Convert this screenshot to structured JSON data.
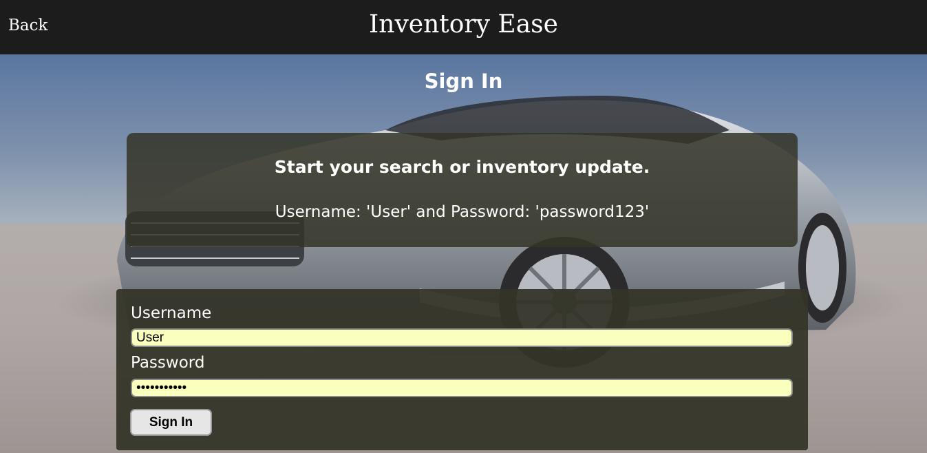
{
  "header": {
    "back_label": "Back",
    "app_title": "Inventory Ease"
  },
  "page": {
    "heading": "Sign In"
  },
  "info_panel": {
    "headline": "Start your search or inventory update.",
    "credentials_hint": "Username: 'User' and Password: 'password123'"
  },
  "form": {
    "username_label": "Username",
    "username_value": "User",
    "password_label": "Password",
    "password_value": "password123",
    "submit_label": "Sign In"
  },
  "colors": {
    "header_bg": "#1c1c1c",
    "panel_bg": "#343428",
    "input_bg": "#faffbd",
    "button_bg": "#e6e6e6"
  },
  "images": {
    "background": "silver-sports-car-photo"
  }
}
